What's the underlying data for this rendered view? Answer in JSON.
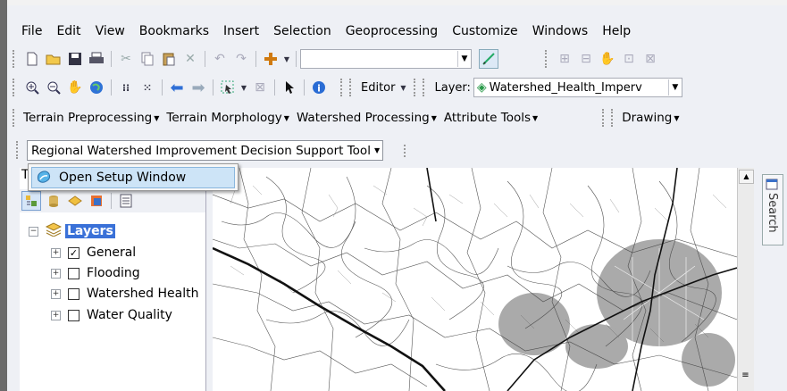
{
  "menubar": [
    "File",
    "Edit",
    "View",
    "Bookmarks",
    "Insert",
    "Selection",
    "Geoprocessing",
    "Customize",
    "Windows",
    "Help"
  ],
  "editor_toolbar": {
    "editor_label": "Editor",
    "layer_label": "Layer:",
    "layer_value": "Watershed_Health_Imperv"
  },
  "toolbar_names": {
    "terrain_preprocessing": "Terrain Preprocessing",
    "terrain_morphology": "Terrain Morphology",
    "watershed_processing": "Watershed Processing",
    "attribute_tools": "Attribute Tools",
    "drawing": "Drawing"
  },
  "tool": {
    "name": "Regional Watershed Improvement Decision Support Tool",
    "menu_item": "Open Setup Window"
  },
  "toc": {
    "header_prefix": "T",
    "root": "Layers",
    "items": [
      {
        "label": "General",
        "checked": true
      },
      {
        "label": "Flooding",
        "checked": false
      },
      {
        "label": "Watershed Health",
        "checked": false
      },
      {
        "label": "Water Quality",
        "checked": false
      }
    ]
  },
  "search_tab": "Search",
  "icons": [
    "new-document-icon",
    "open-folder-icon",
    "save-icon",
    "print-icon",
    "cut-icon",
    "copy-icon",
    "paste-icon",
    "delete-icon",
    "undo-icon",
    "redo-icon",
    "add-data-icon",
    "zoom-in-icon",
    "zoom-out-icon",
    "pan-icon",
    "globe-icon",
    "identify-icon",
    "select-arrow-icon"
  ],
  "colors": {
    "accent": "#2f6fd6",
    "selection": "#cde4f7",
    "layers_highlight": "#3a71d8"
  }
}
